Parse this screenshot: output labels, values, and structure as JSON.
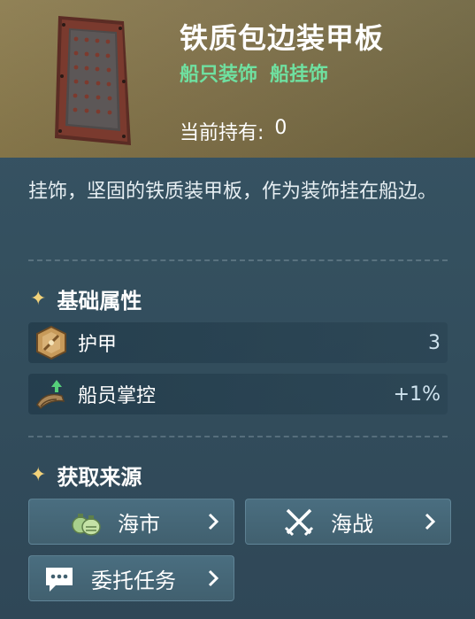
{
  "item": {
    "name": "铁质包边装甲板",
    "tags": [
      "船只装饰",
      "船挂饰"
    ],
    "owned_label": "当前持有:",
    "owned_value": "0",
    "image_icon": "armor-plate-icon"
  },
  "description": "挂饰，坚固的铁质装甲板，作为装饰挂在船边。",
  "base_attributes": {
    "title": "基础属性",
    "stats": [
      {
        "label": "护甲",
        "value": "3",
        "icon": "armor-icon"
      },
      {
        "label": "船员掌控",
        "value": "+1%",
        "icon": "crew-control-icon"
      }
    ]
  },
  "sources": {
    "title": "获取来源",
    "buttons": [
      {
        "label": "海市",
        "icon": "money-bags-icon"
      },
      {
        "label": "海战",
        "icon": "crossed-swords-icon"
      },
      {
        "label": "委托任务",
        "icon": "chat-bubble-icon"
      }
    ]
  },
  "colors": {
    "header_bg": "#8a7a4c",
    "panel_bg": "#395466",
    "tag_green": "#6fe0a0",
    "sparkle_gold": "#f2d27a"
  }
}
